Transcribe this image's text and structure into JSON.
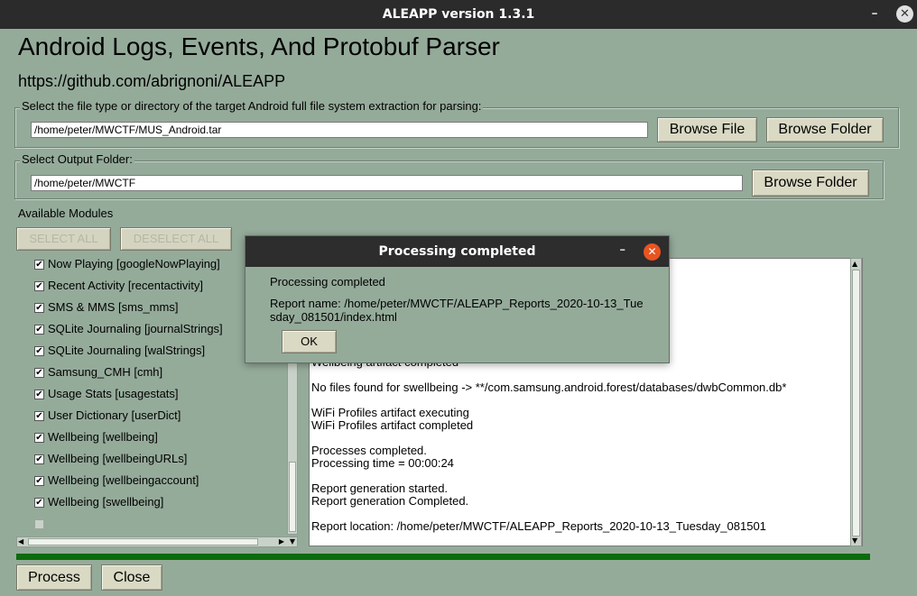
{
  "window": {
    "title": "ALEAPP version 1.3.1",
    "minimize_icon": "minimize-icon",
    "close_icon": "close-icon"
  },
  "header": {
    "title": "Android Logs, Events, And Protobuf Parser",
    "url": "https://github.com/abrignoni/ALEAPP"
  },
  "input_section": {
    "label": "Select the file type or directory of the target Android full file system extraction for parsing:",
    "value": "/home/peter/MWCTF/MUS_Android.tar",
    "browse_file_label": "Browse File",
    "browse_folder_label": "Browse Folder"
  },
  "output_section": {
    "label": "Select Output Folder:",
    "value": "/home/peter/MWCTF",
    "browse_folder_label": "Browse Folder"
  },
  "modules": {
    "label": "Available Modules",
    "select_all_label": "SELECT ALL",
    "deselect_all_label": "DESELECT ALL",
    "items": [
      {
        "label": "Now Playing [googleNowPlaying]",
        "checked": true
      },
      {
        "label": "Recent Activity [recentactivity]",
        "checked": true
      },
      {
        "label": "SMS & MMS [sms_mms]",
        "checked": true
      },
      {
        "label": "SQLite Journaling [journalStrings]",
        "checked": true
      },
      {
        "label": "SQLite Journaling [walStrings]",
        "checked": true
      },
      {
        "label": "Samsung_CMH [cmh]",
        "checked": true
      },
      {
        "label": "Usage Stats [usagestats]",
        "checked": true
      },
      {
        "label": "User Dictionary [userDict]",
        "checked": true
      },
      {
        "label": "Wellbeing [wellbeing]",
        "checked": true
      },
      {
        "label": "Wellbeing [wellbeingURLs]",
        "checked": true
      },
      {
        "label": "Wellbeing [wellbeingaccount]",
        "checked": true
      },
      {
        "label": "Wellbeing [swellbeing]",
        "checked": true
      },
      {
        "label": "",
        "checked": false
      }
    ]
  },
  "log": {
    "lines": [
      "Wellbeing artifact completed",
      "",
      "No files found for swellbeing -> **/com.samsung.android.forest/databases/dwbCommon.db*",
      "",
      "WiFi Profiles artifact executing",
      "WiFi Profiles artifact completed",
      "",
      "Processes completed.",
      "Processing time = 00:00:24",
      "",
      "Report generation started.",
      "Report generation Completed.",
      "",
      "Report location: /home/peter/MWCTF/ALEAPP_Reports_2020-10-13_Tuesday_081501"
    ]
  },
  "progress": {
    "value": 1.0,
    "color": "#0c6b0c"
  },
  "footer": {
    "process_label": "Process",
    "close_label": "Close"
  },
  "dialog": {
    "title": "Processing completed",
    "message": "Processing completed",
    "report_line1": "Report name: /home/peter/MWCTF/ALEAPP_Reports_2020-10-13_Tue",
    "report_line2": "sday_081501/index.html",
    "ok_label": "OK",
    "close_color": "#e95420"
  }
}
